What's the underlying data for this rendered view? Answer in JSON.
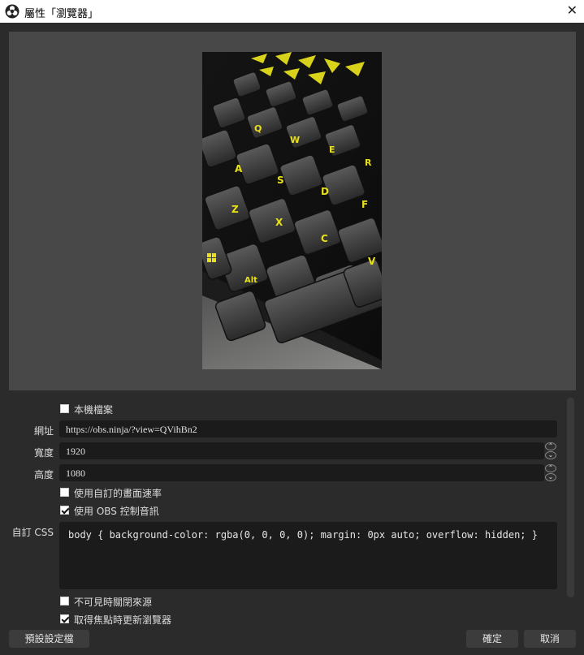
{
  "window": {
    "title": "屬性「瀏覽器」",
    "close_glyph": "✕"
  },
  "form": {
    "local_file_label": "本機檔案",
    "url_label": "網址",
    "url_value": "https://obs.ninja/?view=QVihBn2",
    "width_label": "寬度",
    "width_value": "1920",
    "height_label": "高度",
    "height_value": "1080",
    "custom_fps_label": "使用自訂的畫面速率",
    "obs_audio_label": "使用 OBS 控制音訊",
    "custom_css_label": "自訂 CSS",
    "custom_css_value": "body { background-color: rgba(0, 0, 0, 0); margin: 0px auto; overflow: hidden; }",
    "shutdown_hidden_label": "不可見時關閉來源",
    "refresh_active_label": "取得焦點時更新瀏覽器"
  },
  "checkboxes": {
    "local_file": false,
    "custom_fps": false,
    "obs_audio": true,
    "shutdown_hidden": false,
    "refresh_active": true
  },
  "buttons": {
    "defaults": "預設設定檔",
    "ok": "確定",
    "cancel": "取消"
  },
  "colors": {
    "background": "#2b2b2b",
    "preview_bg": "#484848",
    "field_bg": "#1b1b1b",
    "key_legend_yellow": "#e8e01a"
  }
}
